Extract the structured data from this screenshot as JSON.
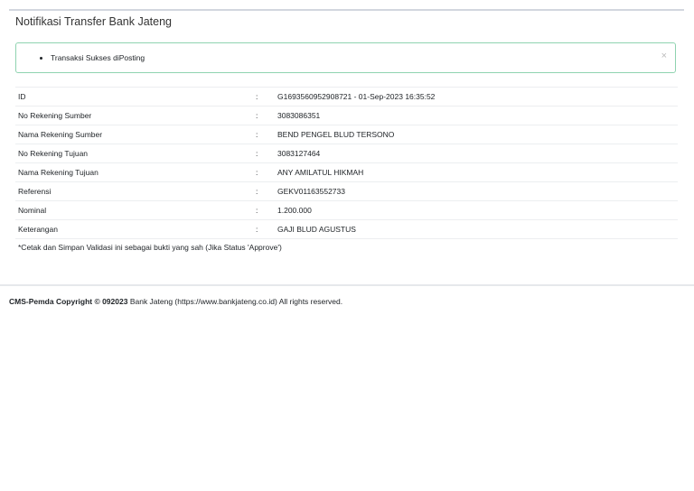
{
  "title": "Notifikasi Transfer Bank Jateng",
  "alert": {
    "message": "Transaksi Sukses diPosting",
    "close": "×"
  },
  "rows": [
    {
      "label": "ID",
      "value": "G1693560952908721 - 01-Sep-2023 16:35:52"
    },
    {
      "label": "No Rekening Sumber",
      "value": "3083086351"
    },
    {
      "label": "Nama Rekening Sumber",
      "value": "BEND PENGEL BLUD TERSONO"
    },
    {
      "label": "No Rekening Tujuan",
      "value": "3083127464"
    },
    {
      "label": "Nama Rekening Tujuan",
      "value": "ANY AMILATUL HIKMAH"
    },
    {
      "label": "Referensi",
      "value": "GEKV01163552733"
    },
    {
      "label": "Nominal",
      "value": "1.200.000"
    },
    {
      "label": "Keterangan",
      "value": "GAJI BLUD AGUSTUS"
    }
  ],
  "separator": ":",
  "note": "*Cetak dan Simpan Validasi ini sebagai bukti yang sah (Jika Status 'Approve')",
  "footer": {
    "brand": "CMS-Pemda Copyright © 092023",
    "text": " Bank Jateng (https://www.bankjateng.co.id) All rights reserved."
  }
}
